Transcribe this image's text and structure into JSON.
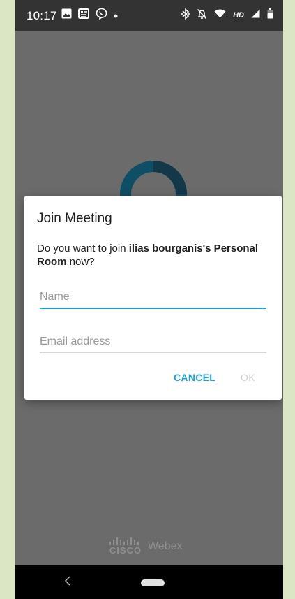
{
  "status_bar": {
    "time": "10:17",
    "hd": "HD",
    "left_icons": [
      "image-icon",
      "news-icon",
      "viber-icon",
      "dot-icon"
    ],
    "right_icons": [
      "bluetooth-icon",
      "silent-icon",
      "wifi-icon",
      "signal-icon",
      "battery-icon"
    ]
  },
  "dialog": {
    "title": "Join Meeting",
    "message_prefix": "Do you want to join ",
    "message_bold": "ilias bourganis's Personal Room",
    "message_suffix": " now?",
    "name_placeholder": "Name",
    "name_value": "",
    "email_placeholder": "Email address",
    "email_value": "",
    "cancel_label": "CANCEL",
    "ok_label": "OK"
  },
  "branding": {
    "cisco": "CISCO",
    "product": "Webex"
  },
  "colors": {
    "accent": "#1aa3d9",
    "background": "#6b6b6b",
    "status_bar": "#333333"
  }
}
